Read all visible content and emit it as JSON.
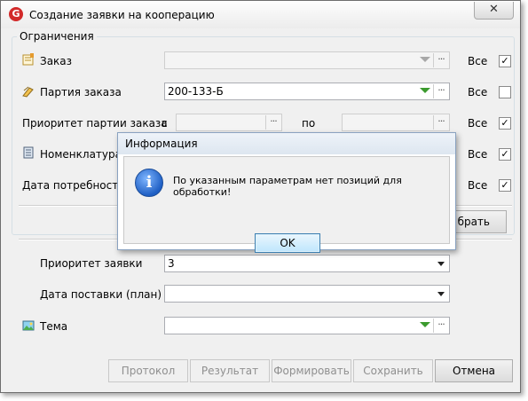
{
  "window": {
    "title": "Создание заявки на кооперацию",
    "app_icon": "G",
    "close": "✕"
  },
  "group": {
    "title": "Ограничения"
  },
  "fields": {
    "order": {
      "label": "Заказ",
      "value": "",
      "all_label": "Все",
      "all_checked": true
    },
    "batch": {
      "label": "Партия заказа",
      "value": "200-133-Б",
      "all_label": "Все",
      "all_checked": false
    },
    "priority": {
      "label": "Приоритет партии заказа",
      "from_label": "с",
      "to_label": "по",
      "from_value": "",
      "to_value": "",
      "all_label": "Все",
      "all_checked": true
    },
    "nomenclature": {
      "label": "Номенклатура",
      "value": "",
      "all_label": "Все",
      "all_checked": true
    },
    "need_date": {
      "label": "Дата потребности",
      "value": "",
      "all_label": "Все",
      "all_checked": true
    }
  },
  "select_button": {
    "label": "брать"
  },
  "request": {
    "priority_label": "Приоритет заявки",
    "priority_value": "3",
    "delivery_label": "Дата поставки (план)",
    "delivery_value": "",
    "theme_label": "Тема",
    "theme_value": ""
  },
  "buttons": {
    "protocol": "Протокол",
    "result": "Результат",
    "form": "Формировать",
    "save": "Сохранить",
    "cancel": "Отмена"
  },
  "dialog": {
    "title": "Информация",
    "message": "По указанным параметрам нет позиций для обработки!",
    "ok": "OK",
    "icon": "info-icon"
  },
  "glyphs": {
    "dots": "···",
    "check": "✓",
    "info": "i"
  }
}
